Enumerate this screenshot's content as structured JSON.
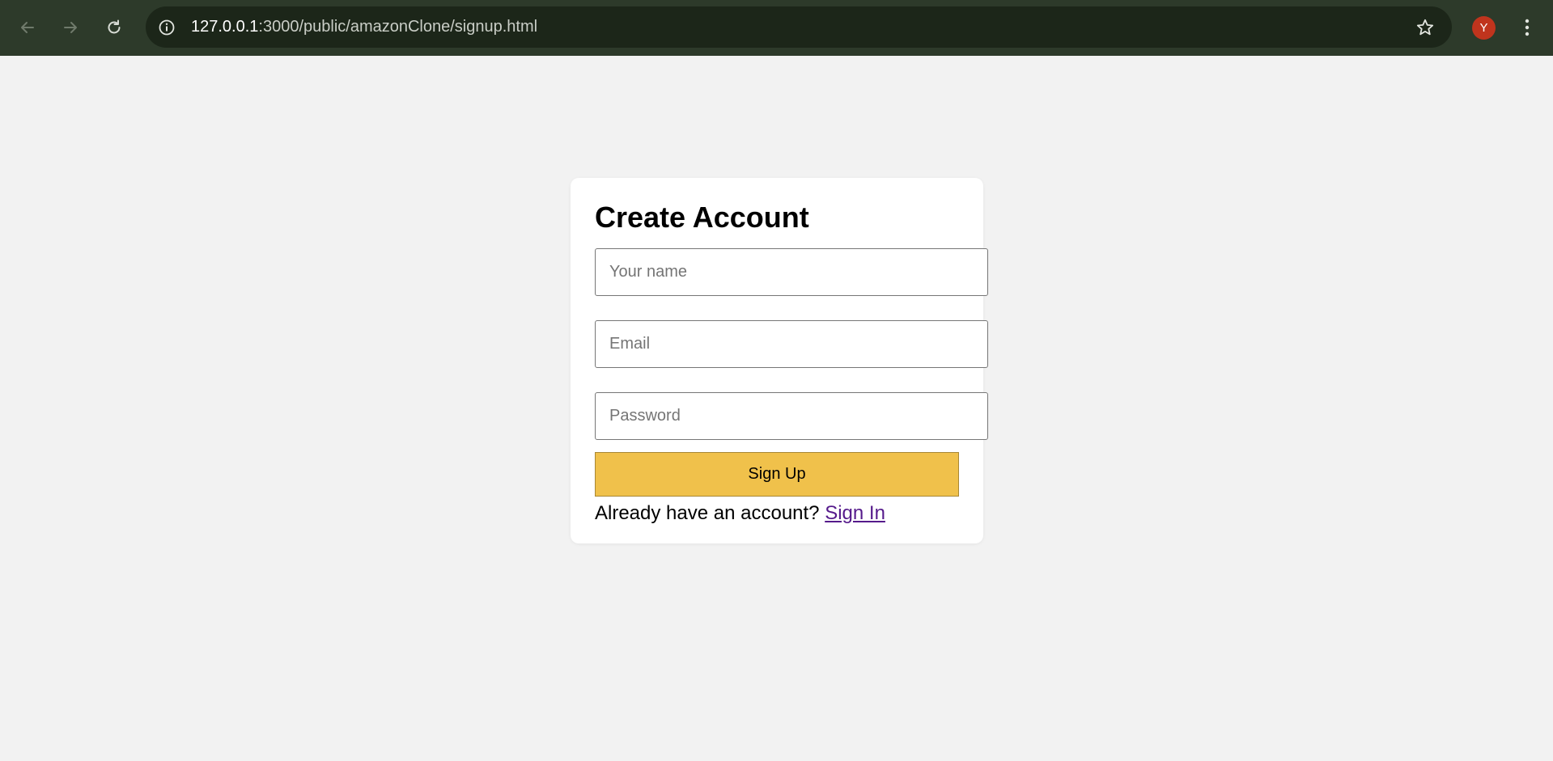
{
  "browser": {
    "url_host": "127.0.0.1",
    "url_rest": ":3000/public/amazonClone/signup.html",
    "profile_initial": "Y",
    "icons": {
      "back": "back-arrow-icon",
      "forward": "forward-arrow-icon",
      "reload": "reload-icon",
      "site_info": "info-icon",
      "bookmark": "star-icon",
      "menu": "kebab-menu-icon"
    },
    "colors": {
      "toolbar": "#2d3a2a",
      "omnibox": "#1c2619",
      "avatar": "#c0341d"
    }
  },
  "signup": {
    "title": "Create Account",
    "name_placeholder": "Your name",
    "email_placeholder": "Email",
    "password_placeholder": "Password",
    "submit_label": "Sign Up",
    "prompt_text": "Already have an account?",
    "signin_link": "Sign In",
    "colors": {
      "button": "#f0c14b",
      "button_border": "#a88734",
      "link": "#551a8b",
      "page_bg": "#f2f2f2"
    }
  }
}
